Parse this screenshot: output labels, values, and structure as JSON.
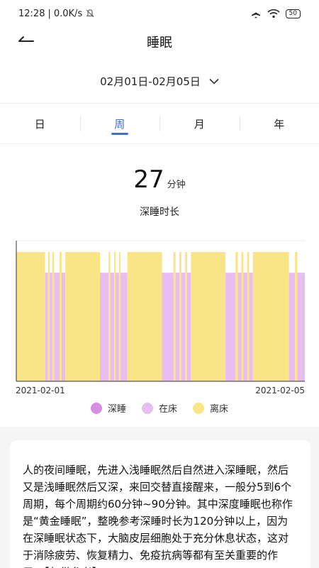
{
  "status_bar": {
    "time": "12:28",
    "network_speed": "0.0K/s",
    "battery": "50",
    "icons": [
      "mute-icon",
      "airplane-icon",
      "wifi-icon",
      "battery-icon"
    ]
  },
  "header": {
    "title": "睡眠",
    "back_icon": "back-arrow-icon"
  },
  "date_range": {
    "label": "02月01日-02月05日",
    "icon": "chevron-down-icon"
  },
  "tabs": [
    {
      "label": "日",
      "active": false
    },
    {
      "label": "周",
      "active": true
    },
    {
      "label": "月",
      "active": false
    },
    {
      "label": "年",
      "active": false
    }
  ],
  "summary": {
    "value": "27",
    "unit": "分钟",
    "label": "深睡时长"
  },
  "chart_data": {
    "type": "bar",
    "x_start_label": "2021-02-01",
    "x_end_label": "2021-02-05",
    "x_range": [
      0,
      1
    ],
    "levels": {
      "离床": 1.0,
      "深睡": 0.84,
      "在床": 0.84
    },
    "colors": {
      "深睡": "#d68ee3",
      "在床": "#e8bdf0",
      "离床": "#f9e586"
    },
    "segments": [
      {
        "from": 0.0,
        "to": 0.1,
        "state": "离床"
      },
      {
        "from": 0.1,
        "to": 0.11,
        "state": "在床"
      },
      {
        "from": 0.11,
        "to": 0.116,
        "state": "离床"
      },
      {
        "from": 0.116,
        "to": 0.125,
        "state": "在床"
      },
      {
        "from": 0.125,
        "to": 0.131,
        "state": "离床"
      },
      {
        "from": 0.131,
        "to": 0.15,
        "state": "在床"
      },
      {
        "from": 0.15,
        "to": 0.157,
        "state": "离床"
      },
      {
        "from": 0.157,
        "to": 0.17,
        "state": "在床"
      },
      {
        "from": 0.17,
        "to": 0.29,
        "state": "离床"
      },
      {
        "from": 0.29,
        "to": 0.32,
        "state": "在床"
      },
      {
        "from": 0.32,
        "to": 0.326,
        "state": "离床"
      },
      {
        "from": 0.326,
        "to": 0.339,
        "state": "在床"
      },
      {
        "from": 0.339,
        "to": 0.344,
        "state": "离床"
      },
      {
        "from": 0.344,
        "to": 0.356,
        "state": "在床"
      },
      {
        "from": 0.356,
        "to": 0.361,
        "state": "离床"
      },
      {
        "from": 0.361,
        "to": 0.385,
        "state": "在床"
      },
      {
        "from": 0.385,
        "to": 0.505,
        "state": "离床"
      },
      {
        "from": 0.505,
        "to": 0.545,
        "state": "在床"
      },
      {
        "from": 0.545,
        "to": 0.552,
        "state": "离床"
      },
      {
        "from": 0.552,
        "to": 0.565,
        "state": "在床"
      },
      {
        "from": 0.565,
        "to": 0.572,
        "state": "离床"
      },
      {
        "from": 0.572,
        "to": 0.585,
        "state": "在床"
      },
      {
        "from": 0.585,
        "to": 0.592,
        "state": "离床"
      },
      {
        "from": 0.592,
        "to": 0.605,
        "state": "在床"
      },
      {
        "from": 0.605,
        "to": 0.725,
        "state": "离床"
      },
      {
        "from": 0.725,
        "to": 0.76,
        "state": "在床"
      },
      {
        "from": 0.76,
        "to": 0.768,
        "state": "离床"
      },
      {
        "from": 0.768,
        "to": 0.78,
        "state": "在床"
      },
      {
        "from": 0.78,
        "to": 0.787,
        "state": "离床"
      },
      {
        "from": 0.787,
        "to": 0.8,
        "state": "在床"
      },
      {
        "from": 0.8,
        "to": 0.807,
        "state": "离床"
      },
      {
        "from": 0.807,
        "to": 0.82,
        "state": "在床"
      },
      {
        "from": 0.82,
        "to": 0.945,
        "state": "离床"
      },
      {
        "from": 0.945,
        "to": 0.966,
        "state": "在床"
      },
      {
        "from": 0.966,
        "to": 0.974,
        "state": "离床"
      },
      {
        "from": 0.974,
        "to": 1.0,
        "state": "在床"
      }
    ],
    "legend": [
      {
        "name": "深睡",
        "color": "#d68ee3"
      },
      {
        "name": "在床",
        "color": "#e8bdf0"
      },
      {
        "name": "离床",
        "color": "#f9e586"
      }
    ],
    "legend_position": "bottom"
  },
  "info_card": {
    "text": "人的夜间睡眠，先进入浅睡眠然后自然进入深睡眠，然后又是浅睡眠然后又深，来回交替直接醒来，一般分5到6个周期，每个周期约60分钟~90分钟。其中深度睡眠也称作是“黄金睡眠”，整晚参考深睡时长为120分钟以上，因为在深睡眠状态下，大脑皮层细胞处于充分休息状态，这对于消除疲劳、恢复精力、免疫抗病等都有至关重要的作用。【仅供参考】"
  },
  "colors": {
    "accent": "#3f6fd8"
  }
}
